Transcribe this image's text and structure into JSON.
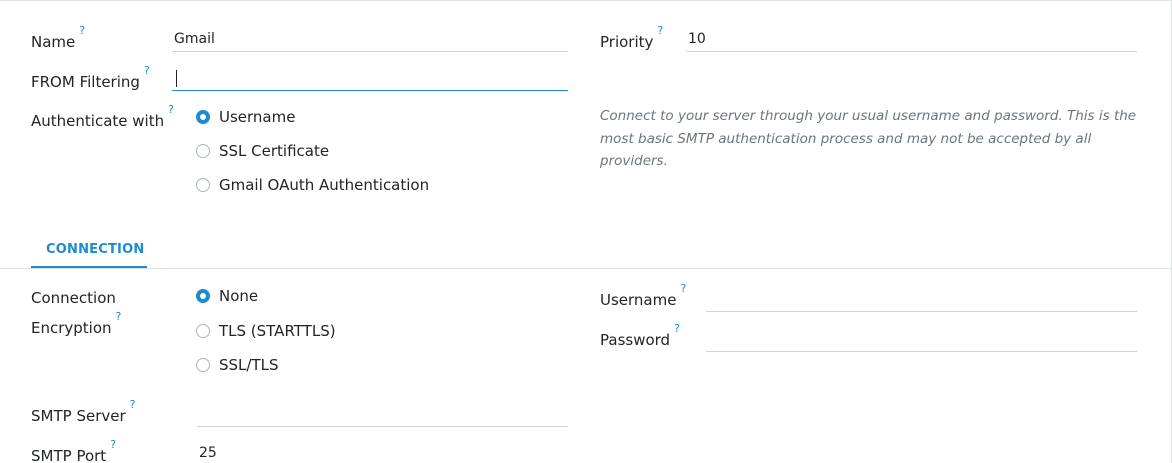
{
  "form": {
    "name_label": "Name",
    "name_value": "Gmail",
    "priority_label": "Priority",
    "priority_value": "10",
    "from_filter_label": "FROM Filtering",
    "from_filter_value": "",
    "auth_label": "Authenticate with",
    "auth_options": [
      {
        "label": "Username",
        "checked": true
      },
      {
        "label": "SSL Certificate",
        "checked": false
      },
      {
        "label": "Gmail OAuth Authentication",
        "checked": false
      }
    ],
    "auth_hint": "Connect to your server through your usual username and password. This is the most basic SMTP authentication process and may not be accepted by all providers.",
    "help_marker": "?"
  },
  "tabs": [
    {
      "label": "CONNECTION",
      "active": true
    }
  ],
  "connection": {
    "encryption_label": "Connection Encryption",
    "encryption_options": [
      {
        "label": "None",
        "checked": true
      },
      {
        "label": "TLS (STARTTLS)",
        "checked": false
      },
      {
        "label": "SSL/TLS",
        "checked": false
      }
    ],
    "username_label": "Username",
    "username_value": "",
    "password_label": "Password",
    "password_value": "",
    "smtp_server_label": "SMTP Server",
    "smtp_server_value": "",
    "smtp_port_label": "SMTP Port",
    "smtp_port_value": "25"
  },
  "colors": {
    "accent": "#1a8ccf",
    "text": "#212529",
    "muted": "#6c757d",
    "border": "#ced4da"
  }
}
